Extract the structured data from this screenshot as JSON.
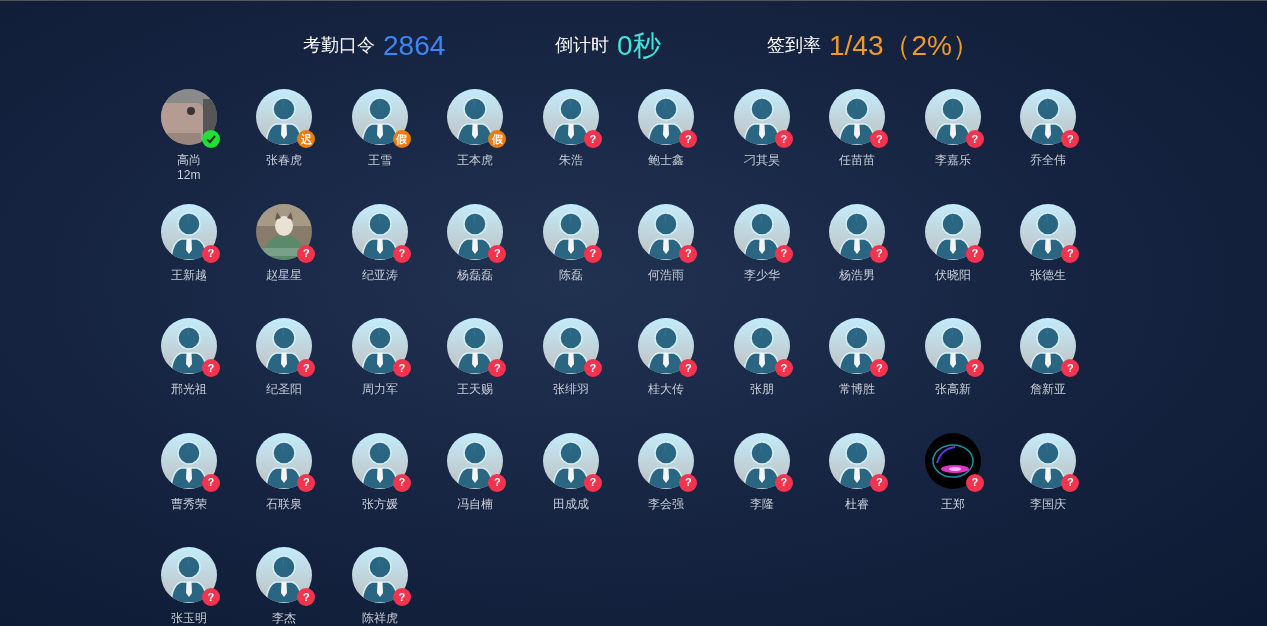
{
  "header": [
    {
      "label": "考勤口令",
      "value": "2864",
      "kind": "code"
    },
    {
      "label": "倒计时",
      "value": "0秒",
      "kind": "countdown"
    },
    {
      "label": "签到率",
      "value": "1/43（2%）",
      "kind": "rate"
    }
  ],
  "people": [
    {
      "name": "高尚",
      "note": "12m",
      "badge": {
        "kind": "present"
      }
    },
    {
      "name": "张春虎",
      "avatar": {
        "kind": "default"
      },
      "badge": {
        "kind": "late",
        "text": "迟"
      }
    },
    {
      "name": "王雪",
      "avatar": {
        "kind": "default"
      },
      "badge": {
        "kind": "leave",
        "text": "假"
      }
    },
    {
      "name": "王本虎",
      "avatar": {
        "kind": "default"
      },
      "badge": {
        "kind": "leave",
        "text": "假"
      }
    },
    {
      "name": "朱浩",
      "avatar": {
        "kind": "default"
      },
      "badge": {
        "kind": "absent",
        "text": "?"
      }
    },
    {
      "name": "鲍士鑫",
      "avatar": {
        "kind": "default"
      },
      "badge": {
        "kind": "absent",
        "text": "?"
      }
    },
    {
      "name": "刁其昊",
      "avatar": {
        "kind": "default"
      },
      "badge": {
        "kind": "absent",
        "text": "?"
      }
    },
    {
      "name": "任苗苗",
      "avatar": {
        "kind": "default"
      },
      "badge": {
        "kind": "absent",
        "text": "?"
      }
    },
    {
      "name": "李嘉乐",
      "avatar": {
        "kind": "default"
      },
      "badge": {
        "kind": "absent",
        "text": "?"
      }
    },
    {
      "name": "乔全伟",
      "avatar": {
        "kind": "default"
      },
      "badge": {
        "kind": "absent",
        "text": "?"
      }
    },
    {
      "name": "王新越",
      "avatar": {
        "kind": "default"
      },
      "badge": {
        "kind": "absent",
        "text": "?"
      }
    },
    {
      "name": "赵星星",
      "badge": {
        "kind": "absent",
        "text": "?"
      }
    },
    {
      "name": "纪亚涛",
      "avatar": {
        "kind": "default"
      },
      "badge": {
        "kind": "absent",
        "text": "?"
      }
    },
    {
      "name": "杨磊磊",
      "avatar": {
        "kind": "default"
      },
      "badge": {
        "kind": "absent",
        "text": "?"
      }
    },
    {
      "name": "陈磊",
      "avatar": {
        "kind": "default"
      },
      "badge": {
        "kind": "absent",
        "text": "?"
      }
    },
    {
      "name": "何浩雨",
      "avatar": {
        "kind": "default"
      },
      "badge": {
        "kind": "absent",
        "text": "?"
      }
    },
    {
      "name": "李少华",
      "avatar": {
        "kind": "default"
      },
      "badge": {
        "kind": "absent",
        "text": "?"
      }
    },
    {
      "name": "杨浩男",
      "avatar": {
        "kind": "default"
      },
      "badge": {
        "kind": "absent",
        "text": "?"
      }
    },
    {
      "name": "伏晓阳",
      "avatar": {
        "kind": "default"
      },
      "badge": {
        "kind": "absent",
        "text": "?"
      }
    },
    {
      "name": "张德生",
      "avatar": {
        "kind": "default"
      },
      "badge": {
        "kind": "absent",
        "text": "?"
      }
    },
    {
      "name": "邢光祖",
      "avatar": {
        "kind": "default"
      },
      "badge": {
        "kind": "absent",
        "text": "?"
      }
    },
    {
      "name": "纪圣阳",
      "avatar": {
        "kind": "default"
      },
      "badge": {
        "kind": "absent",
        "text": "?"
      }
    },
    {
      "name": "周力军",
      "avatar": {
        "kind": "default"
      },
      "badge": {
        "kind": "absent",
        "text": "?"
      }
    },
    {
      "name": "王天赐",
      "avatar": {
        "kind": "default"
      },
      "badge": {
        "kind": "absent",
        "text": "?"
      }
    },
    {
      "name": "张绯羽",
      "avatar": {
        "kind": "default"
      },
      "badge": {
        "kind": "absent",
        "text": "?"
      }
    },
    {
      "name": "桂大传",
      "avatar": {
        "kind": "default"
      },
      "badge": {
        "kind": "absent",
        "text": "?"
      }
    },
    {
      "name": "张朋",
      "avatar": {
        "kind": "default"
      },
      "badge": {
        "kind": "absent",
        "text": "?"
      }
    },
    {
      "name": "常博胜",
      "avatar": {
        "kind": "default"
      },
      "badge": {
        "kind": "absent",
        "text": "?"
      }
    },
    {
      "name": "张高新",
      "avatar": {
        "kind": "default"
      },
      "badge": {
        "kind": "absent",
        "text": "?"
      }
    },
    {
      "name": "詹新亚",
      "avatar": {
        "kind": "default"
      },
      "badge": {
        "kind": "absent",
        "text": "?"
      }
    },
    {
      "name": "曹秀荣",
      "avatar": {
        "kind": "default"
      },
      "badge": {
        "kind": "absent",
        "text": "?"
      }
    },
    {
      "name": "石联泉",
      "avatar": {
        "kind": "default"
      },
      "badge": {
        "kind": "absent",
        "text": "?"
      }
    },
    {
      "name": "张方媛",
      "avatar": {
        "kind": "default"
      },
      "badge": {
        "kind": "absent",
        "text": "?"
      }
    },
    {
      "name": "冯自楠",
      "avatar": {
        "kind": "default"
      },
      "badge": {
        "kind": "absent",
        "text": "?"
      }
    },
    {
      "name": "田成成",
      "avatar": {
        "kind": "default"
      },
      "badge": {
        "kind": "absent",
        "text": "?"
      }
    },
    {
      "name": "李会强",
      "avatar": {
        "kind": "default"
      },
      "badge": {
        "kind": "absent",
        "text": "?"
      }
    },
    {
      "name": "李隆",
      "avatar": {
        "kind": "default"
      },
      "badge": {
        "kind": "absent",
        "text": "?"
      }
    },
    {
      "name": "杜睿",
      "avatar": {
        "kind": "default"
      },
      "badge": {
        "kind": "absent",
        "text": "?"
      }
    },
    {
      "name": "王郑",
      "badge": {
        "kind": "absent",
        "text": "?"
      }
    },
    {
      "name": "李国庆",
      "avatar": {
        "kind": "default"
      },
      "badge": {
        "kind": "absent",
        "text": "?"
      }
    },
    {
      "name": "张玉明",
      "avatar": {
        "kind": "default"
      },
      "badge": {
        "kind": "absent",
        "text": "?"
      }
    },
    {
      "name": "李杰",
      "avatar": {
        "kind": "default"
      },
      "badge": {
        "kind": "absent",
        "text": "?"
      }
    },
    {
      "name": "陈祥虎",
      "avatar": {
        "kind": "default"
      },
      "badge": {
        "kind": "absent",
        "text": "?"
      }
    }
  ]
}
